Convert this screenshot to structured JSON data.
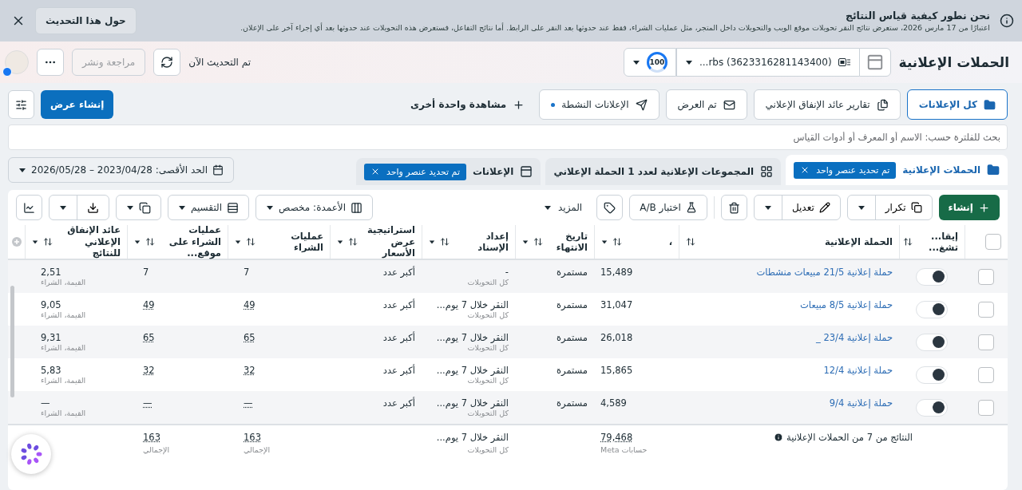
{
  "banner": {
    "title": "نحن نطور كيفية قياس النتائج",
    "text": "اعتبارًا من 17 مارس 2026، ستعرض نتائج النقر تحويلات موقع الويب والتحويلات داخل المتجر، مثل عمليات الشراء، فقط عند حدوثها بعد النقر على الرابط. أما نتائج التفاعل، فستعرض هذه التحويلات عند حدوثها بعد أي إجراء آخر على الإعلان.",
    "button": "حول هذا التحديث"
  },
  "header": {
    "title": "الحملات الإعلانية",
    "account": "...rbs (3623316281143400)",
    "score": "100",
    "status": "تم التحديث الآن",
    "review_button": {
      "label": "مراجعة ونشر",
      "disabled": true
    }
  },
  "views": [
    {
      "label": "كل الإعلانات",
      "selected": true
    },
    {
      "label": "تقارير عائد الإنفاق الإعلاني",
      "selected": false
    },
    {
      "label": "تم العرض",
      "selected": false
    },
    {
      "label": "الإعلانات النشطة",
      "selected": false
    }
  ],
  "add_view": "مشاهدة واحدة أخرى",
  "create_view": "إنشاء عرض",
  "search": {
    "placeholder": "بحث للفلترة حسب: الاسم أو المعرف أو أدوات القياس"
  },
  "tabs": [
    {
      "label": "الحملات الإعلانية",
      "selected": true,
      "chip": "تم تحديد عنصر واحد"
    },
    {
      "label": "المجموعات الإعلانية لعدد 1 الحملة الإعلاني",
      "selected": false
    },
    {
      "label": "الإعلانات",
      "selected": false,
      "chip": "تم تحديد عنصر واحد"
    }
  ],
  "date_range": "الحد الأقصى: 2023/04/28 – 2026/05/28",
  "toolbar": {
    "create": "إنشاء",
    "duplicate": "تكرار",
    "edit": "تعديل",
    "ab_test": "اختبار A/B",
    "more": "المزيد",
    "columns": "الأعمدة: مخصص",
    "breakdown": "التقسيم"
  },
  "table": {
    "all_checked": false,
    "columns": [
      "إيقا... تشغ...",
      "الحملة الإعلانية",
      "،",
      "تاريخ الانتهاء",
      "إعداد الإسناد",
      "استراتيجية عرض الأسعار",
      "عمليات الشراء",
      "عمليات الشراء على موقع...",
      "عائد الإنفاق الإعلاني للنتائج"
    ],
    "rows": [
      {
        "checked": false,
        "on": true,
        "name": "حملة إعلانية 21/5 مبيعات منشطات",
        "column_3": "15,489",
        "end_date": "مستمرة",
        "attribution": "-",
        "attribution_sub": "كل التحويلات",
        "bid_strategy": "أكبر عدد",
        "purchases": "7",
        "purchases_web": "7",
        "roas": "2,51",
        "roas_sub": "القيمة، الشراء"
      },
      {
        "checked": false,
        "on": true,
        "name": "حملة إعلانية 8/5 مبيعات",
        "column_3": "31,047",
        "end_date": "مستمرة",
        "attribution": "النقر خلال 7 يوم...",
        "attribution_sub": "كل التحويلات",
        "bid_strategy": "أكبر عدد",
        "purchases": "49",
        "purchases_web": "49",
        "roas": "9,05",
        "roas_sub": "القيمة، الشراء"
      },
      {
        "checked": false,
        "on": true,
        "name": "حملة إعلانية 23/4 _",
        "column_3": "26,018",
        "end_date": "مستمرة",
        "attribution": "النقر خلال 7 يوم...",
        "attribution_sub": "كل التحويلات",
        "bid_strategy": "أكبر عدد",
        "purchases": "65",
        "purchases_web": "65",
        "roas": "9,31",
        "roas_sub": "القيمة، الشراء"
      },
      {
        "checked": false,
        "on": true,
        "name": "حملة إعلانية 12/4",
        "column_3": "15,865",
        "end_date": "مستمرة",
        "attribution": "النقر خلال 7 يوم...",
        "attribution_sub": "كل التحويلات",
        "bid_strategy": "أكبر عدد",
        "purchases": "32",
        "purchases_web": "32",
        "roas": "5,83",
        "roas_sub": "القيمة، الشراء"
      },
      {
        "checked": false,
        "on": true,
        "name": "حملة إعلانية 9/4",
        "column_3": "4,589",
        "end_date": "مستمرة",
        "attribution": "النقر خلال 7 يوم...",
        "attribution_sub": "كل التحويلات",
        "bid_strategy": "أكبر عدد",
        "purchases": "—",
        "purchases_web": "—",
        "roas": "—",
        "roas_sub": "القيمة، الشراء"
      }
    ],
    "footer": {
      "label": "النتائج من 7 من الحملات الإعلانية",
      "column_3": "79,468",
      "column_3_sub": "حسابات Meta",
      "attribution": "النقر خلال 7 يوم...",
      "attribution_sub": "كل التحويلات",
      "purchases": "163",
      "purchases_sub": "الإجمالي",
      "purchases_web": "163",
      "purchases_web_sub": "الإجمالي"
    }
  }
}
